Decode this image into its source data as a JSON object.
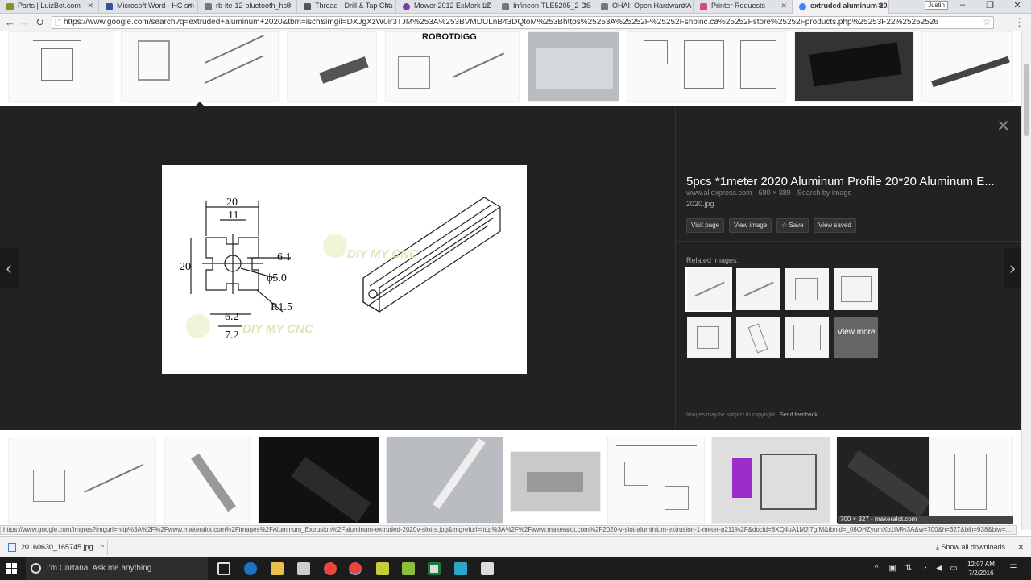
{
  "browser": {
    "tabs": [
      {
        "label": "Parts | LuizBot.com",
        "color": "#8c8c2a"
      },
      {
        "label": "Microsoft Word - HC sm",
        "color": "#2b579a"
      },
      {
        "label": "rb-ite-12-bluetooth_hc0",
        "color": "#777777"
      },
      {
        "label": "Thread - Drill & Tap Cha",
        "color": "#555555"
      },
      {
        "label": "Mower 2012 ExMark LZ",
        "color": "#7b3fa0"
      },
      {
        "label": "Infineon-TLE5205_2-DS",
        "color": "#777777"
      },
      {
        "label": "OHAI: Open Hardware A",
        "color": "#777777"
      },
      {
        "label": "Printer Requests",
        "color": "#d14c8e"
      },
      {
        "label": "extruded aluminum 202",
        "color": "#4285f4"
      }
    ],
    "user_badge": "Justin",
    "address": "https://www.google.com/search?q=extruded+aluminum+2020&tbm=isch&imgil=DXJgXzW0ir3TJM%253A%253BVMDULnB43DQtoM%253Bhttps%25253A%25252F%25252Fsnbinc.ca%25252Fstore%25252Fproducts.php%25253F22%25252526",
    "window_buttons": {
      "minimize": "–",
      "maximize": "❐",
      "close": "✕"
    }
  },
  "top_strip": {
    "caption": "ROBOTDIGG"
  },
  "preview": {
    "title": "5pcs *1meter 2020 Aluminum Profile 20*20 Aluminum E...",
    "meta": "www.aliexpress.com · 680 × 389 · Search by image",
    "filename": "2020.jpg",
    "actions": {
      "visit": "Visit page",
      "view_image": "View image",
      "save": "☆ Save",
      "view_saved": "View saved"
    },
    "related_label": "Related images:",
    "view_more": "View more",
    "disclaimer": "Images may be subject to copyright",
    "feedback": "Send feedback",
    "drawing": {
      "dim_width": "20",
      "dim_slot": "11",
      "dim_height": "20",
      "dim_groove": "6.1",
      "dim_hole": "ϕ5.0",
      "dim_radius": "R1.5",
      "dim_62": "6.2",
      "dim_72": "7.2",
      "watermark": "DIY MY CNC"
    }
  },
  "bottom_strip": {
    "caption": "700 × 327 - makeralot.com"
  },
  "status_url": "https://www.google.com/imgres?imgurl=http%3A%2F%2Fwww.makeralot.com%2Fimages%2FAluminum_Extrusion%2Faluminum-extruded-2020v-slot-s.jpg&imgrefurl=http%3A%2F%2Fwww.makeralot.com%2F2020-v-slot-aluminium-extrusion-1-meter-p211%2F&docid=8XQ4uA1MJf7gfM&tbnid=_08OHZyumXb1iM%3A&w=700&h=327&bih=938&biw=...",
  "downloads": {
    "file": "20160630_165745.jpg",
    "show_all": "Show all downloads..."
  },
  "taskbar": {
    "cortana": "I'm Cortana. Ask me anything.",
    "time": "12:07 AM",
    "date": "7/2/2016"
  }
}
